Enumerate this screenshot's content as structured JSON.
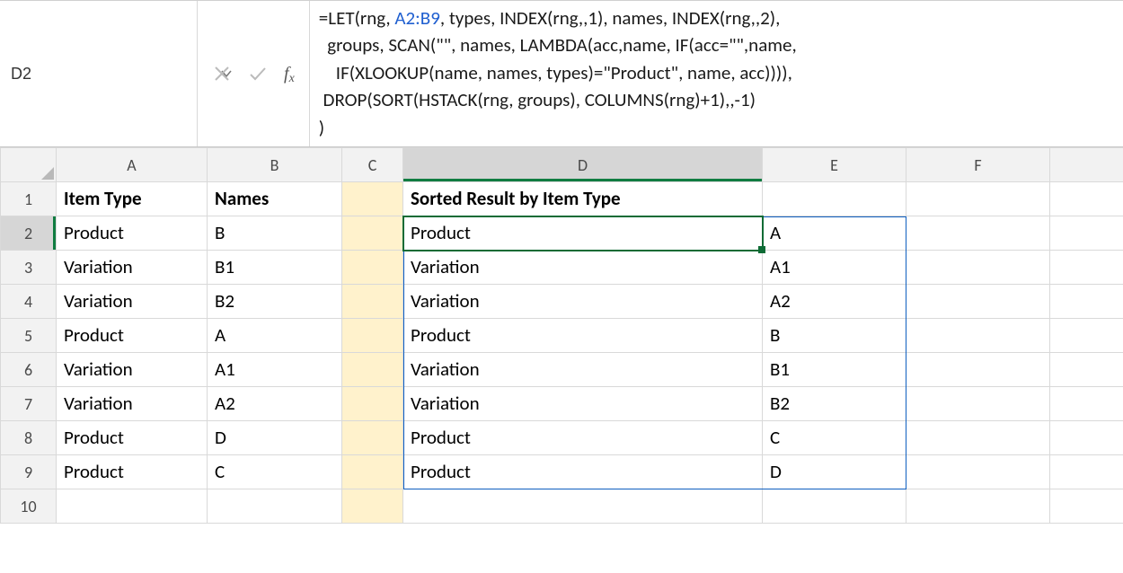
{
  "nameBox": {
    "value": "D2"
  },
  "formulaBar": {
    "prefix": "=LET(rng, ",
    "rangeRef": "A2:B9",
    "line1_rest": ", types, INDEX(rng,,1), names, INDEX(rng,,2),",
    "line2": "  groups, SCAN(\"\", names, LAMBDA(acc,name, IF(acc=\"\",name,",
    "line3": "    IF(XLOOKUP(name, names, types)=\"Product\", name, acc)))),",
    "line4": " DROP(SORT(HSTACK(rng, groups), COLUMNS(rng)+1),,-1)",
    "line5": ")"
  },
  "columns": [
    "A",
    "B",
    "C",
    "D",
    "E",
    "F"
  ],
  "rowCount": 10,
  "activeColumn": "D",
  "activeRow": 2,
  "headers": {
    "A1": "Item Type",
    "B1": "Names",
    "D1": "Sorted Result by Item Type"
  },
  "source": [
    {
      "type": "Product",
      "name": "B"
    },
    {
      "type": "Variation",
      "name": "B1"
    },
    {
      "type": "Variation",
      "name": "B2"
    },
    {
      "type": "Product",
      "name": "A"
    },
    {
      "type": "Variation",
      "name": "A1"
    },
    {
      "type": "Variation",
      "name": "A2"
    },
    {
      "type": "Product",
      "name": "D"
    },
    {
      "type": "Product",
      "name": "C"
    }
  ],
  "result": [
    {
      "type": "Product",
      "name": "A"
    },
    {
      "type": "Variation",
      "name": "A1"
    },
    {
      "type": "Variation",
      "name": "A2"
    },
    {
      "type": "Product",
      "name": "B"
    },
    {
      "type": "Variation",
      "name": "B1"
    },
    {
      "type": "Variation",
      "name": "B2"
    },
    {
      "type": "Product",
      "name": "C"
    },
    {
      "type": "Product",
      "name": "D"
    }
  ],
  "icons": {
    "cancel": "cancel-icon",
    "enter": "enter-icon",
    "fx": "fx-icon",
    "caret": "name-box-caret"
  }
}
